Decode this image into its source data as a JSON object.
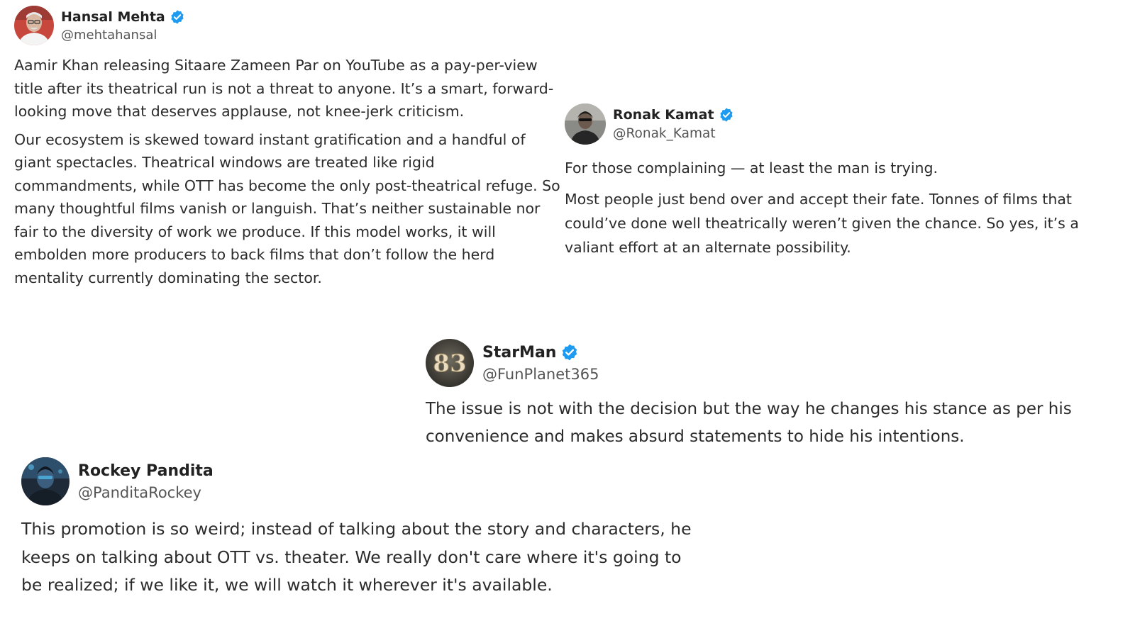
{
  "colors": {
    "verified_badge": "#1d9bf0",
    "body_text": "#2b2b2b",
    "handle_text": "#555555",
    "background": "#ffffff"
  },
  "tweets": [
    {
      "display_name": "Hansal Mehta",
      "handle": "@mehtahansal",
      "verified": true,
      "avatar_icon": "profile-photo-avatar",
      "paragraphs": [
        "Aamir Khan releasing Sitaare Zameen Par on YouTube as a pay-per-view title after its theatrical run is not a threat to anyone. It’s a smart, forward-looking move that deserves applause, not knee-jerk criticism.",
        "Our ecosystem is skewed toward instant gratification and a handful of giant spectacles. Theatrical windows are treated like rigid commandments, while OTT has become the only post-theatrical refuge. So many thoughtful films vanish or languish. That’s neither sustainable nor fair to the diversity of work we produce. If this model works, it will embolden more producers to back films that don’t follow the herd mentality currently dominating the sector."
      ]
    },
    {
      "display_name": "Ronak Kamat",
      "handle": "@Ronak_Kamat",
      "verified": true,
      "avatar_icon": "profile-photo-avatar",
      "paragraphs": [
        "For those complaining — at least the man is trying.",
        "Most people just bend over and accept their fate. Tonnes of films that could’ve done well theatrically weren’t given the chance. So yes, it’s a valiant effort at an alternate possibility."
      ]
    },
    {
      "display_name": "StarMan",
      "handle": "@FunPlanet365",
      "verified": true,
      "avatar_icon": "83-logo-avatar",
      "avatar_text": "83",
      "paragraphs": [
        "The issue is not with the decision but the way he changes his stance as per his convenience and makes absurd statements to hide his intentions."
      ]
    },
    {
      "display_name": "Rockey Pandita",
      "handle": "@PanditaRockey",
      "verified": false,
      "avatar_icon": "profile-photo-avatar",
      "paragraphs": [
        "This promotion is so weird; instead of talking about the story and characters, he keeps on talking about OTT vs. theater. We really don't care where it's going to be realized; if we like it, we will watch it wherever it's available."
      ]
    }
  ]
}
